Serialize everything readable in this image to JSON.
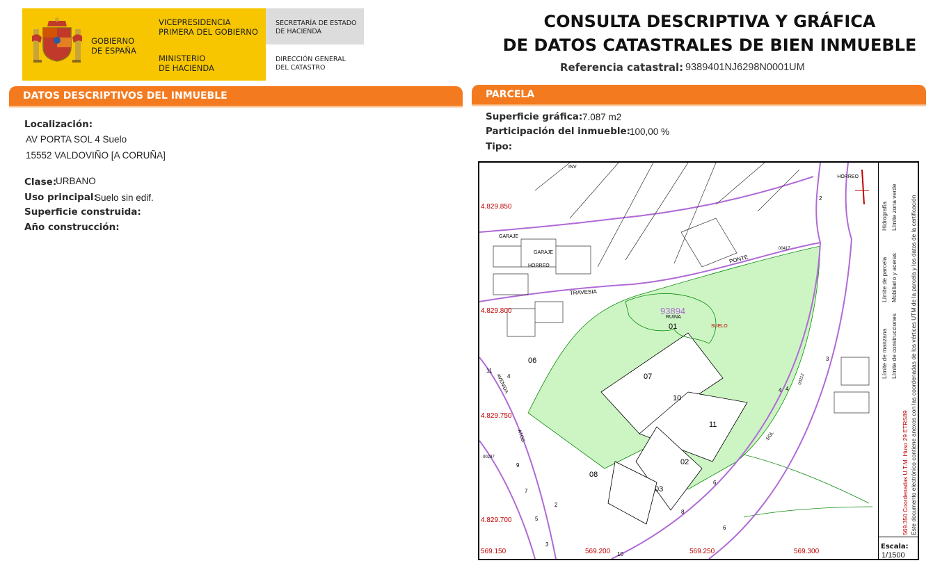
{
  "header": {
    "gobierno": "GOBIERNO\nDE ESPAÑA",
    "vicepresidencia": "VICEPRESIDENCIA\nPRIMERA DEL GOBIERNO",
    "ministerio": "MINISTERIO\nDE HACIENDA",
    "secretaria": "SECRETARÍA DE ESTADO\nDE HACIENDA",
    "direccion": "DIRECCIÓN GENERAL\nDEL CATASTRO",
    "title": "CONSULTA DESCRIPTIVA Y GRÁFICA\nDE DATOS CATASTRALES DE BIEN INMUEBLE",
    "ref_label": "Referencia catastral:",
    "ref_value": "9389401NJ6298N0001UM"
  },
  "colors": {
    "accent": "#f47a1f",
    "logo_yellow": "#f7c600",
    "parcel_green": "#cdf5c4",
    "purple": "#b06ad6",
    "red": "#cc0000"
  },
  "descriptivos": {
    "section_title": "DATOS DESCRIPTIVOS DEL INMUEBLE",
    "localizacion_label": "Localización:",
    "address_line1": "AV PORTA SOL 4 Suelo",
    "address_line2": "15552 VALDOVIÑO [A CORUÑA]",
    "clase_label": "Clase:",
    "clase_value": "URBANO",
    "uso_label": "Uso principal:",
    "uso_value": "Suelo sin edif.",
    "superficie_label": "Superficie construida:",
    "anio_label": "Año construcción:"
  },
  "parcela": {
    "section_title": "PARCELA",
    "superficie_label": "Superficie gráfica:",
    "superficie_value": "7.087 m2",
    "participacion_label": "Participación del inmueble:",
    "participacion_value": "100,00 %",
    "tipo_label": "Tipo:"
  },
  "map": {
    "y_coords": [
      "4.829.850",
      "4.829.800",
      "4.829.750",
      "4.829.700"
    ],
    "x_coords": [
      "569.150",
      "569.200",
      "569.250",
      "569.300"
    ],
    "parcel_ref": "93894",
    "parcel_label": "RUINA",
    "suelo_label": "SUELO",
    "lot_numbers": [
      "01",
      "06",
      "07",
      "10",
      "11",
      "02",
      "03",
      "08"
    ],
    "street_labels": [
      "TRAVESIA",
      "PONTE",
      "AVENIDA",
      "ATOS",
      "SOL"
    ],
    "building_labels": [
      "GARAJE",
      "GARAJE",
      "HORREO",
      "HORREO",
      "INV"
    ],
    "small_labels": [
      "00417",
      "00212",
      "00297"
    ],
    "street_numbers": [
      "2",
      "4",
      "3",
      "4",
      "11",
      "9",
      "7",
      "5",
      "3",
      "2",
      "4",
      "6",
      "8",
      "10",
      "6"
    ],
    "scale_label": "Escala:",
    "scale_value": "1/1500",
    "legend": {
      "col1": [
        "Límite de manzana",
        "Límite de parcela",
        "Hidrografía"
      ],
      "col2": [
        "Límite de construcciones",
        "Mobiliario y aceras",
        "Límite zona verde"
      ],
      "coords_note": "569.350 Coordenadas U.T.M. Huso 29 ETRS89",
      "doc_note": "Este documento electrónico contiene anexos con las coordenadas de los vértices UTM de la parcela y los datos de la certificación"
    }
  }
}
